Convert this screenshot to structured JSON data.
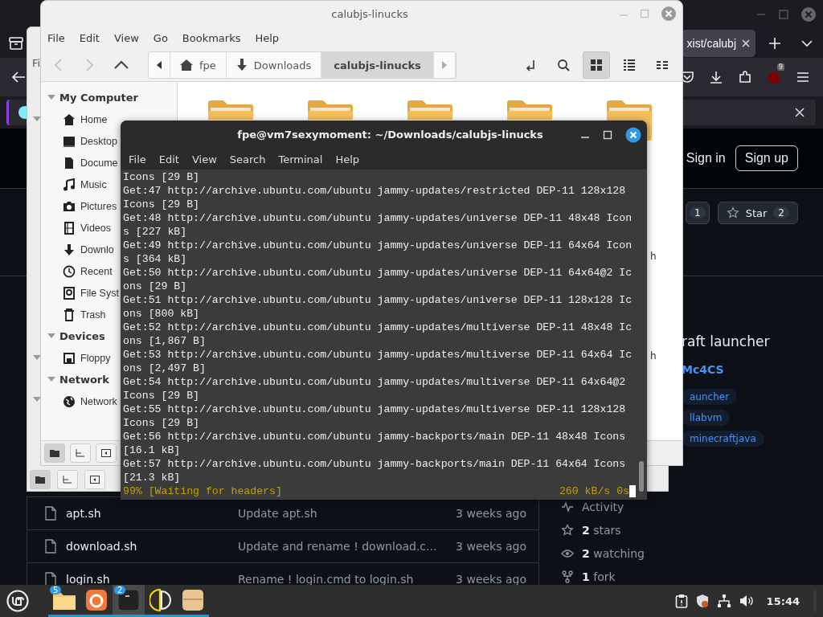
{
  "browser": {
    "tab": {
      "title": "xist/calubj"
    },
    "extension_badge": "9",
    "header": {
      "sign_in": "Sign in",
      "sign_up": "Sign up"
    },
    "repo_buttons": [
      {
        "kind": "count",
        "count": "1"
      },
      {
        "kind": "star",
        "label": "Star",
        "count": "2"
      }
    ],
    "about": {
      "description": "raft launcher",
      "link": "Mc4CS",
      "topics": [
        "auncher",
        "llabvm",
        "minecraftjava"
      ]
    },
    "files": [
      {
        "name": "apt.sh",
        "message": "Update apt.sh",
        "date": "3 weeks ago"
      },
      {
        "name": "download.sh",
        "message": "Update and rename ! download.c...",
        "date": "3 weeks ago"
      },
      {
        "name": "login.sh",
        "message": "Rename ! login.cmd to login.sh",
        "date": "3 weeks ago"
      }
    ],
    "stats": [
      {
        "kind": "activity",
        "label": "Activity"
      },
      {
        "kind": "stars",
        "count": "2",
        "label": "stars"
      },
      {
        "kind": "watching",
        "count": "2",
        "label": "watching"
      },
      {
        "kind": "fork",
        "count": "1",
        "label": "fork"
      }
    ]
  },
  "back_file_manager": {
    "menu": "Fi",
    "tree_toggles": [
      {
        "expanded": true
      },
      {
        "expanded": true
      },
      {
        "expanded": true
      }
    ],
    "status_buttons": [
      {
        "kind": "places",
        "selected": true
      },
      {
        "kind": "tree",
        "selected": false
      },
      {
        "kind": "hide",
        "selected": false
      }
    ]
  },
  "file_manager": {
    "title": "calubjs-linucks",
    "menu": [
      "File",
      "Edit",
      "View",
      "Go",
      "Bookmarks",
      "Help"
    ],
    "breadcrumb": [
      {
        "kind": "home",
        "label": "fpe",
        "selected": false
      },
      {
        "kind": "download",
        "label": "Downloads",
        "selected": false
      },
      {
        "kind": "folder",
        "label": "calubjs-linucks",
        "selected": true
      }
    ],
    "view_buttons": [
      {
        "kind": "location",
        "selected": false
      },
      {
        "kind": "search",
        "selected": false
      },
      {
        "kind": "icons",
        "selected": true
      },
      {
        "kind": "list",
        "selected": false
      },
      {
        "kind": "compact",
        "selected": false
      }
    ],
    "sidebar": [
      {
        "title": "My Computer",
        "expanded": true,
        "items": [
          {
            "kind": "home",
            "label": "Home"
          },
          {
            "kind": "desktop",
            "label": "Desktop"
          },
          {
            "kind": "document",
            "label": "Docume"
          },
          {
            "kind": "music",
            "label": "Music"
          },
          {
            "kind": "camera",
            "label": "Pictures"
          },
          {
            "kind": "film",
            "label": "Videos"
          },
          {
            "kind": "download",
            "label": "Downlo"
          },
          {
            "kind": "clock",
            "label": "Recent"
          },
          {
            "kind": "drive",
            "label": "File Syst"
          },
          {
            "kind": "trash",
            "label": "Trash"
          }
        ]
      },
      {
        "title": "Devices",
        "expanded": true,
        "items": [
          {
            "kind": "floppy",
            "label": "Floppy"
          }
        ]
      },
      {
        "title": "Network",
        "expanded": true,
        "items": [
          {
            "kind": "globe",
            "label": "Network"
          }
        ]
      }
    ],
    "items": [
      {
        "kind": "folder"
      },
      {
        "kind": "folder"
      },
      {
        "kind": "folder"
      },
      {
        "kind": "folder"
      },
      {
        "kind": "folder"
      }
    ],
    "partial_labels": [
      "h",
      "h"
    ],
    "status_buttons": [
      {
        "kind": "places",
        "selected": true
      },
      {
        "kind": "tree",
        "selected": false
      },
      {
        "kind": "hide",
        "selected": false
      }
    ]
  },
  "terminal": {
    "title": "fpe@vm7sexymoment: ~/Downloads/calubjs-linucks",
    "menu": [
      "File",
      "Edit",
      "View",
      "Search",
      "Terminal",
      "Help"
    ],
    "lines": [
      "Icons [29 B]",
      "Get:47 http://archive.ubuntu.com/ubuntu jammy-updates/restricted DEP-11 128x128",
      "Icons [29 B]",
      "Get:48 http://archive.ubuntu.com/ubuntu jammy-updates/universe DEP-11 48x48 Icon",
      "s [227 kB]",
      "Get:49 http://archive.ubuntu.com/ubuntu jammy-updates/universe DEP-11 64x64 Icon",
      "s [364 kB]",
      "Get:50 http://archive.ubuntu.com/ubuntu jammy-updates/universe DEP-11 64x64@2 Ic",
      "ons [29 B]",
      "Get:51 http://archive.ubuntu.com/ubuntu jammy-updates/universe DEP-11 128x128 Ic",
      "ons [800 kB]",
      "Get:52 http://archive.ubuntu.com/ubuntu jammy-updates/multiverse DEP-11 48x48 Ic",
      "ons [1,867 B]",
      "Get:53 http://archive.ubuntu.com/ubuntu jammy-updates/multiverse DEP-11 64x64 Ic",
      "ons [2,497 B]",
      "Get:54 http://archive.ubuntu.com/ubuntu jammy-updates/multiverse DEP-11 64x64@2",
      "Icons [29 B]",
      "Get:55 http://archive.ubuntu.com/ubuntu jammy-updates/multiverse DEP-11 128x128",
      "Icons [29 B]",
      "Get:56 http://archive.ubuntu.com/ubuntu jammy-backports/main DEP-11 48x48 Icons",
      "[16.1 kB]",
      "Get:57 http://archive.ubuntu.com/ubuntu jammy-backports/main DEP-11 64x64 Icons",
      "[21.3 kB]"
    ],
    "progress": "99% [Waiting for headers]",
    "rate": "260 kB/s 0s"
  },
  "taskbar": {
    "apps": [
      {
        "kind": "files",
        "badge": "5",
        "selected": false
      },
      {
        "kind": "browser",
        "selected": false
      },
      {
        "kind": "terminal",
        "badge": "2",
        "selected": true
      },
      {
        "kind": "halfmoon",
        "selected": false
      },
      {
        "kind": "box",
        "selected": false
      }
    ],
    "clock": "15:44"
  }
}
